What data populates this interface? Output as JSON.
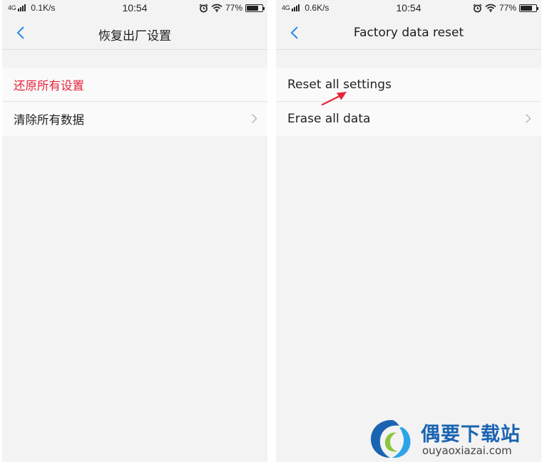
{
  "left": {
    "status": {
      "network": "4G",
      "speed": "0.1K/s",
      "time": "10:54",
      "battery": "77%"
    },
    "title": "恢复出厂设置",
    "items": [
      {
        "label": "还原所有设置"
      },
      {
        "label": "清除所有数据"
      }
    ]
  },
  "right": {
    "status": {
      "network": "4G",
      "speed": "0.6K/s",
      "time": "10:54",
      "battery": "77%"
    },
    "title": "Factory data reset",
    "items": [
      {
        "label": "Reset all settings"
      },
      {
        "label": "Erase all data"
      }
    ]
  },
  "watermark": {
    "name": "偶要下载站",
    "url": "ouyaoxiazai.com"
  },
  "icons": [
    "back-arrow-icon",
    "chevron-right-icon",
    "alarm-icon",
    "wifi-icon",
    "battery-icon",
    "signal-icon",
    "annotation-arrow-icon",
    "site-logo-icon"
  ],
  "colors": {
    "accent": "#2b8be6",
    "highlight_text": "#e8243a",
    "annotation_arrow": "#e8243a",
    "watermark": "#1b64b2"
  },
  "battery_level": 0.77
}
